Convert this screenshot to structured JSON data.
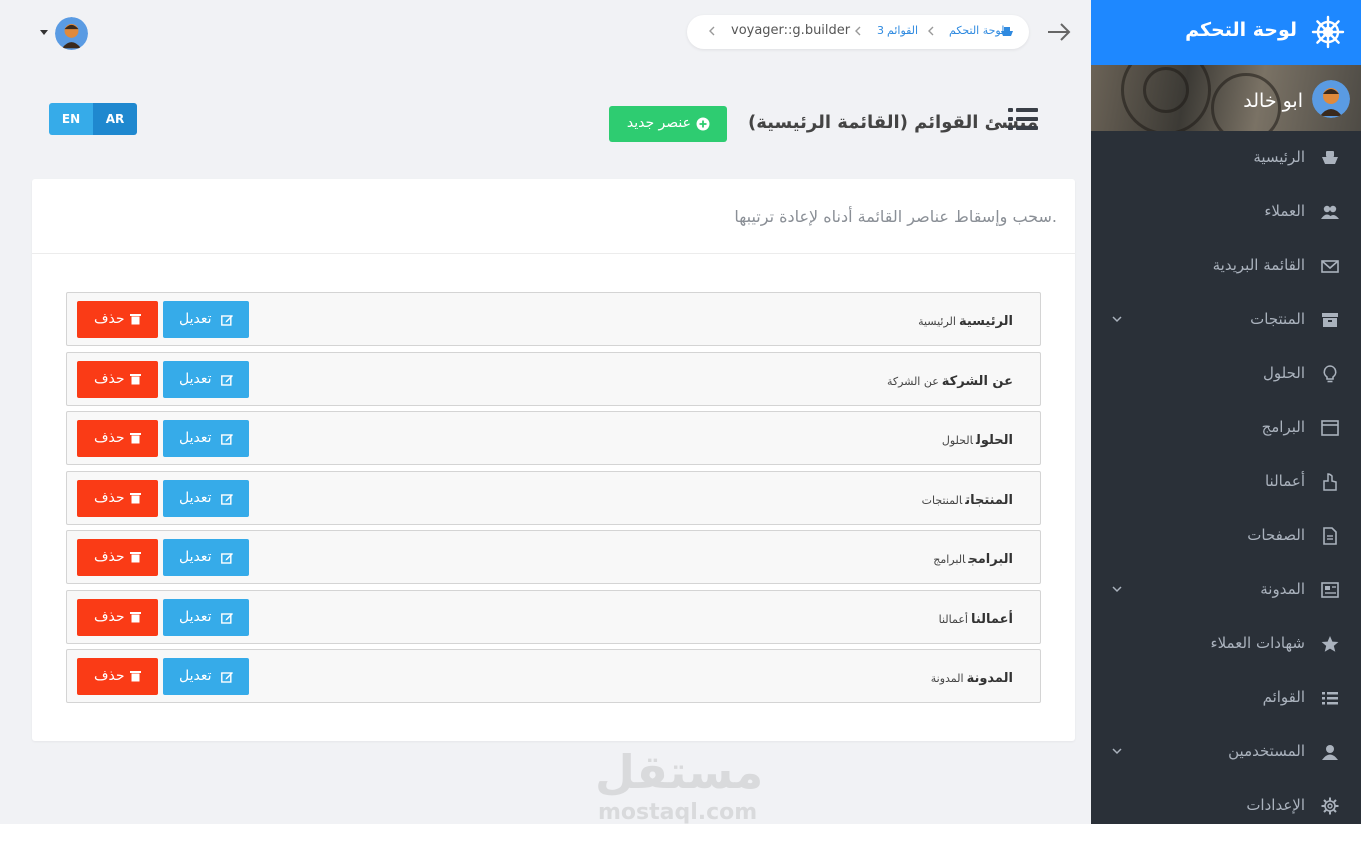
{
  "brand": {
    "title": "لوحة التحكم"
  },
  "user": {
    "name": "ابو خالد"
  },
  "sidebar": {
    "items": [
      {
        "label": "الرئيسية",
        "icon": "boat-icon",
        "has_submenu": false
      },
      {
        "label": "العملاء",
        "icon": "people-icon",
        "has_submenu": false
      },
      {
        "label": "القائمة البريدية",
        "icon": "envelope-icon",
        "has_submenu": false
      },
      {
        "label": "المنتجات",
        "icon": "archive-icon",
        "has_submenu": true
      },
      {
        "label": "الحلول",
        "icon": "lightbulb-icon",
        "has_submenu": false
      },
      {
        "label": "البرامج",
        "icon": "browser-window-icon",
        "has_submenu": false
      },
      {
        "label": "أعمالنا",
        "icon": "hand-thumb-icon",
        "has_submenu": false
      },
      {
        "label": "الصفحات",
        "icon": "document-icon",
        "has_submenu": false
      },
      {
        "label": "المدونة",
        "icon": "news-icon",
        "has_submenu": true
      },
      {
        "label": "شهادات العملاء",
        "icon": "star-icon",
        "has_submenu": false
      },
      {
        "label": "القوائم",
        "icon": "list-icon",
        "has_submenu": false
      },
      {
        "label": "المستخدمين",
        "icon": "person-icon",
        "has_submenu": true
      },
      {
        "label": "الإعدادات",
        "icon": "gear-icon",
        "has_submenu": false
      }
    ]
  },
  "breadcrumb": {
    "items": [
      "لوحة التحكم",
      "القوائم",
      "3"
    ],
    "current": "voyager::g.builder"
  },
  "language": {
    "en": "EN",
    "ar": "AR",
    "active": "AR"
  },
  "header": {
    "title": "منشئ القوائم (القائمة الرئيسية)",
    "add_button": "عنصر جديد"
  },
  "panel": {
    "instructions": "سحب وإسقاط عناصر القائمة أدناه لإعادة ترتيبها.",
    "edit_label": "تعديل",
    "delete_label": "حذف",
    "items": [
      {
        "title": "الرئيسية",
        "url": "الرئيسية"
      },
      {
        "title": "عن الشركة",
        "url": "عن الشركة"
      },
      {
        "title": "الحلول",
        "url": "الحلول"
      },
      {
        "title": "المنتجات",
        "url": "المنتجات"
      },
      {
        "title": "البرامج",
        "url": "البرامج"
      },
      {
        "title": "أعمالنا",
        "url": "أعمالنا"
      },
      {
        "title": "المدونة",
        "url": "المدونة"
      }
    ]
  },
  "watermark": {
    "arabic": "مستقل",
    "latin": "mostaql.com"
  },
  "colors": {
    "sidebar_bg": "#2a3038",
    "brand_bg": "#1e88ff",
    "edit": "#36abe9",
    "delete": "#fa3b16",
    "add": "#2ecc71",
    "lang_en": "#36abe9",
    "lang_ar": "#1f88cf"
  }
}
